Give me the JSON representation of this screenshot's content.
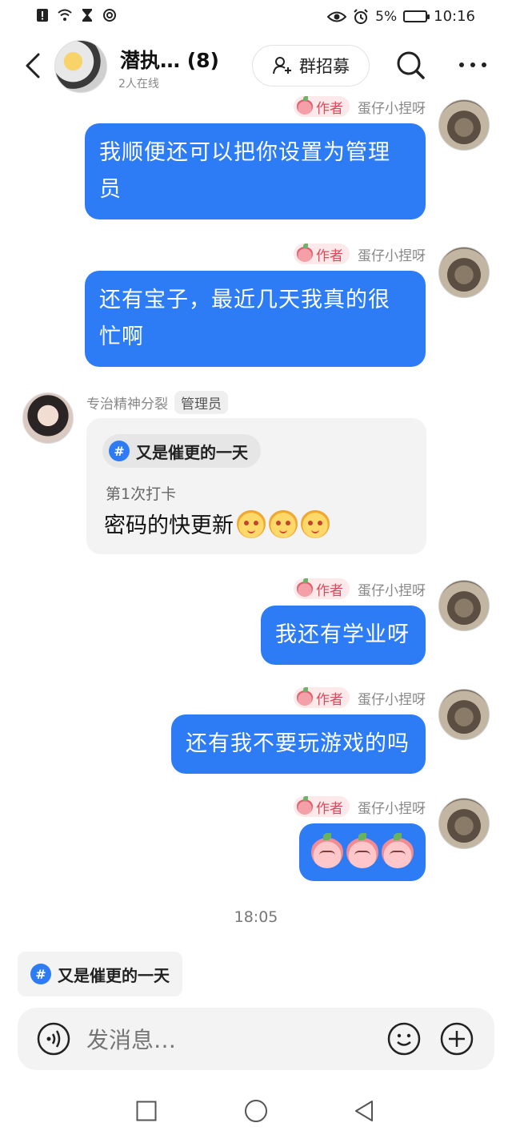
{
  "status_bar": {
    "battery": "5%",
    "time": "10:16",
    "icons": [
      "alert-icon",
      "wifi-icon",
      "hourglass-icon",
      "nfc-icon",
      "eye-icon",
      "alarm-icon",
      "battery-icon"
    ]
  },
  "header": {
    "title": "潜执… (8)",
    "online": "2人在线",
    "recruit_label": "群招募"
  },
  "me": {
    "name": "蛋仔小捏呀",
    "tag": "作者"
  },
  "other": {
    "name": "专治精神分裂",
    "tag": "管理员"
  },
  "messages": {
    "m1": "我顺便还可以把你设置为管理员",
    "m2": "还有宝子，最近几天我真的很忙啊",
    "card": {
      "topic": "又是催更的一天",
      "checkin": "第1次打卡",
      "text": "密码的快更新"
    },
    "m3": "我还有学业呀",
    "m4": "还有我不要玩游戏的吗"
  },
  "timestamp": "18:05",
  "pinned_topic": "又是催更的一天",
  "input": {
    "placeholder": "发消息…"
  },
  "colors": {
    "bubble_blue": "#2d7cf6",
    "author_tag_bg": "#fde8ea",
    "author_tag_text": "#e0485a"
  }
}
